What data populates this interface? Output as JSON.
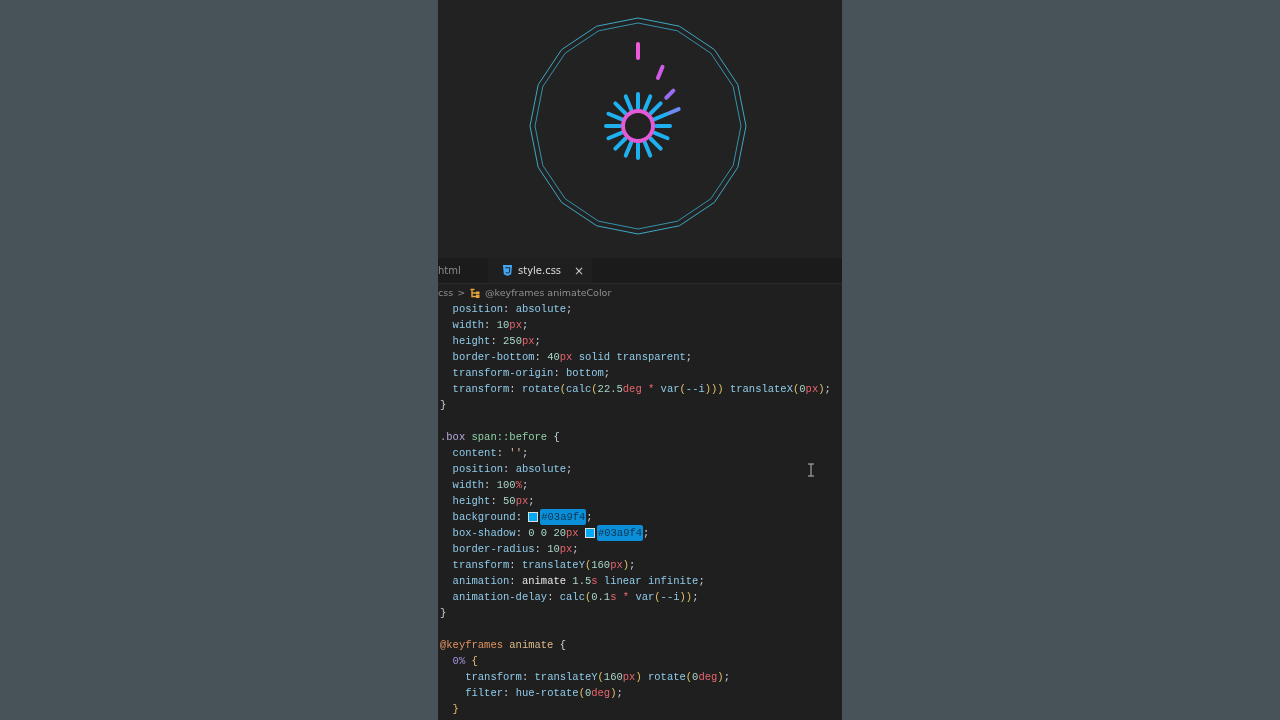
{
  "tabs": [
    {
      "label": "html",
      "selected": false,
      "kind": "plain"
    },
    {
      "label": "style.css",
      "selected": true,
      "kind": "css",
      "close": "×"
    }
  ],
  "breadcrumb": {
    "parts": [
      "css",
      ">"
    ],
    "symbol": "@keyframes animateColor"
  },
  "code_lines": [
    {
      "kind": "code",
      "segments": [
        {
          "kind": "text",
          "tokens": [
            {
              "text": "  position",
              "kind": "property"
            },
            {
              "text": ": ",
              "kind": "punct"
            },
            {
              "text": "absolute",
              "kind": "property"
            },
            {
              "text": ";",
              "kind": "punct"
            }
          ]
        }
      ]
    },
    {
      "kind": "code",
      "segments": [
        {
          "kind": "text",
          "tokens": [
            {
              "text": "  width",
              "kind": "property"
            },
            {
              "text": ": ",
              "kind": "punct"
            },
            {
              "text": "10",
              "kind": "number"
            },
            {
              "text": "px",
              "kind": "unit"
            },
            {
              "text": ";",
              "kind": "punct"
            }
          ]
        }
      ]
    },
    {
      "kind": "code",
      "segments": [
        {
          "kind": "text",
          "tokens": [
            {
              "text": "  height",
              "kind": "property"
            },
            {
              "text": ": ",
              "kind": "punct"
            },
            {
              "text": "250",
              "kind": "number"
            },
            {
              "text": "px",
              "kind": "unit"
            },
            {
              "text": ";",
              "kind": "punct"
            }
          ]
        }
      ]
    },
    {
      "kind": "code",
      "segments": [
        {
          "kind": "text",
          "tokens": [
            {
              "text": "  border-bottom",
              "kind": "property"
            },
            {
              "text": ": ",
              "kind": "punct"
            },
            {
              "text": "40",
              "kind": "number"
            },
            {
              "text": "px",
              "kind": "unit"
            },
            {
              "text": " solid transparent",
              "kind": "property"
            },
            {
              "text": ";",
              "kind": "punct"
            }
          ]
        }
      ]
    },
    {
      "kind": "code",
      "segments": [
        {
          "kind": "text",
          "tokens": [
            {
              "text": "  transform-origin",
              "kind": "property"
            },
            {
              "text": ": ",
              "kind": "punct"
            },
            {
              "text": "bottom",
              "kind": "property"
            },
            {
              "text": ";",
              "kind": "punct"
            }
          ]
        }
      ]
    },
    {
      "kind": "code",
      "segments": [
        {
          "kind": "text",
          "tokens": [
            {
              "text": "  transform",
              "kind": "property"
            },
            {
              "text": ": ",
              "kind": "punct"
            },
            {
              "text": "rotate",
              "kind": "property"
            },
            {
              "text": "(",
              "kind": "paren"
            },
            {
              "text": "calc",
              "kind": "property"
            },
            {
              "text": "(",
              "kind": "paren"
            },
            {
              "text": "22.5",
              "kind": "number"
            },
            {
              "text": "deg",
              "kind": "unit"
            },
            {
              "text": " * ",
              "kind": "operator"
            },
            {
              "text": "var",
              "kind": "property"
            },
            {
              "text": "(",
              "kind": "paren"
            },
            {
              "text": "--i",
              "kind": "property"
            },
            {
              "text": ")))",
              "kind": "paren"
            },
            {
              "text": " translateX",
              "kind": "property"
            },
            {
              "text": "(",
              "kind": "paren"
            },
            {
              "text": "0",
              "kind": "number"
            },
            {
              "text": "px",
              "kind": "unit"
            },
            {
              "text": ")",
              "kind": "paren"
            },
            {
              "text": ";",
              "kind": "punct"
            }
          ]
        }
      ]
    },
    {
      "kind": "code",
      "segments": [
        {
          "kind": "text",
          "tokens": [
            {
              "text": "}",
              "kind": "punct"
            }
          ]
        }
      ]
    },
    {
      "kind": "blank"
    },
    {
      "kind": "code",
      "segments": [
        {
          "kind": "text",
          "tokens": [
            {
              "text": ".box",
              "kind": "selector"
            },
            {
              "text": " span::before",
              "kind": "element"
            },
            {
              "text": " {",
              "kind": "punct"
            }
          ]
        }
      ]
    },
    {
      "kind": "code",
      "segments": [
        {
          "kind": "text",
          "tokens": [
            {
              "text": "  content",
              "kind": "property"
            },
            {
              "text": ": ",
              "kind": "punct"
            },
            {
              "text": "''",
              "kind": "string"
            },
            {
              "text": ";",
              "kind": "punct"
            }
          ]
        }
      ]
    },
    {
      "kind": "code",
      "segments": [
        {
          "kind": "text",
          "tokens": [
            {
              "text": "  position",
              "kind": "property"
            },
            {
              "text": ": ",
              "kind": "punct"
            },
            {
              "text": "absolute",
              "kind": "property"
            },
            {
              "text": ";",
              "kind": "punct"
            }
          ]
        }
      ]
    },
    {
      "kind": "code",
      "segments": [
        {
          "kind": "text",
          "tokens": [
            {
              "text": "  width",
              "kind": "property"
            },
            {
              "text": ": ",
              "kind": "punct"
            },
            {
              "text": "100",
              "kind": "number"
            },
            {
              "text": "%",
              "kind": "unit"
            },
            {
              "text": ";",
              "kind": "punct"
            }
          ]
        }
      ]
    },
    {
      "kind": "code",
      "segments": [
        {
          "kind": "text",
          "tokens": [
            {
              "text": "  height",
              "kind": "property"
            },
            {
              "text": ": ",
              "kind": "punct"
            },
            {
              "text": "50",
              "kind": "number"
            },
            {
              "text": "px",
              "kind": "unit"
            },
            {
              "text": ";",
              "kind": "punct"
            }
          ]
        }
      ]
    },
    {
      "kind": "code",
      "segments": [
        {
          "kind": "text",
          "tokens": [
            {
              "text": "  background",
              "kind": "property"
            },
            {
              "text": ": ",
              "kind": "punct"
            }
          ]
        },
        {
          "kind": "swatch",
          "color": "#03a9f4"
        },
        {
          "kind": "highlight",
          "text": "#03a9f4"
        },
        {
          "kind": "text",
          "tokens": [
            {
              "text": ";",
              "kind": "punct"
            }
          ]
        }
      ]
    },
    {
      "kind": "code",
      "segments": [
        {
          "kind": "text",
          "tokens": [
            {
              "text": "  box-shadow",
              "kind": "property"
            },
            {
              "text": ": ",
              "kind": "punct"
            },
            {
              "text": "0 0 20",
              "kind": "number"
            },
            {
              "text": "px ",
              "kind": "unit"
            }
          ]
        },
        {
          "kind": "swatch",
          "color": "#03a9f4"
        },
        {
          "kind": "highlight",
          "text": "#03a9f4"
        },
        {
          "kind": "text",
          "tokens": [
            {
              "text": ";",
              "kind": "punct"
            }
          ]
        }
      ]
    },
    {
      "kind": "code",
      "segments": [
        {
          "kind": "text",
          "tokens": [
            {
              "text": "  border-radius",
              "kind": "property"
            },
            {
              "text": ": ",
              "kind": "punct"
            },
            {
              "text": "10",
              "kind": "number"
            },
            {
              "text": "px",
              "kind": "unit"
            },
            {
              "text": ";",
              "kind": "punct"
            }
          ]
        }
      ]
    },
    {
      "kind": "code",
      "segments": [
        {
          "kind": "text",
          "tokens": [
            {
              "text": "  transform",
              "kind": "property"
            },
            {
              "text": ": ",
              "kind": "punct"
            },
            {
              "text": "translateY",
              "kind": "property"
            },
            {
              "text": "(",
              "kind": "paren"
            },
            {
              "text": "160",
              "kind": "number"
            },
            {
              "text": "px",
              "kind": "unit"
            },
            {
              "text": ")",
              "kind": "paren"
            },
            {
              "text": ";",
              "kind": "punct"
            }
          ]
        }
      ]
    },
    {
      "kind": "code",
      "segments": [
        {
          "kind": "text",
          "tokens": [
            {
              "text": "  animation",
              "kind": "property"
            },
            {
              "text": ": ",
              "kind": "punct"
            },
            {
              "text": "animate",
              "kind": "plain"
            },
            {
              "text": " 1.5",
              "kind": "number"
            },
            {
              "text": "s",
              "kind": "unit"
            },
            {
              "text": " linear infinite",
              "kind": "property"
            },
            {
              "text": ";",
              "kind": "punct"
            }
          ]
        }
      ]
    },
    {
      "kind": "code",
      "segments": [
        {
          "kind": "text",
          "tokens": [
            {
              "text": "  animation-delay",
              "kind": "property"
            },
            {
              "text": ": ",
              "kind": "punct"
            },
            {
              "text": "calc",
              "kind": "property"
            },
            {
              "text": "(",
              "kind": "paren"
            },
            {
              "text": "0.1",
              "kind": "number"
            },
            {
              "text": "s",
              "kind": "unit"
            },
            {
              "text": " * ",
              "kind": "operator"
            },
            {
              "text": "var",
              "kind": "property"
            },
            {
              "text": "(",
              "kind": "paren"
            },
            {
              "text": "--i",
              "kind": "property"
            },
            {
              "text": "))",
              "kind": "paren"
            },
            {
              "text": ";",
              "kind": "punct"
            }
          ]
        }
      ]
    },
    {
      "kind": "code",
      "segments": [
        {
          "kind": "text",
          "tokens": [
            {
              "text": "}",
              "kind": "punct"
            }
          ]
        }
      ]
    },
    {
      "kind": "blank"
    },
    {
      "kind": "code",
      "segments": [
        {
          "kind": "text",
          "tokens": [
            {
              "text": "@keyframes",
              "kind": "at_rule"
            },
            {
              "text": " animate",
              "kind": "name"
            },
            {
              "text": " {",
              "kind": "punct"
            }
          ]
        }
      ]
    },
    {
      "kind": "code",
      "segments": [
        {
          "kind": "text",
          "tokens": [
            {
              "text": "  0%",
              "kind": "percent"
            },
            {
              "text": " {",
              "kind": "paren"
            }
          ]
        }
      ]
    },
    {
      "kind": "code",
      "segments": [
        {
          "kind": "text",
          "tokens": [
            {
              "text": "    transform",
              "kind": "property"
            },
            {
              "text": ": ",
              "kind": "punct"
            },
            {
              "text": "translateY",
              "kind": "property"
            },
            {
              "text": "(",
              "kind": "paren"
            },
            {
              "text": "160",
              "kind": "number"
            },
            {
              "text": "px",
              "kind": "unit"
            },
            {
              "text": ")",
              "kind": "paren"
            },
            {
              "text": " rotate",
              "kind": "property"
            },
            {
              "text": "(",
              "kind": "paren"
            },
            {
              "text": "0",
              "kind": "number"
            },
            {
              "text": "deg",
              "kind": "unit"
            },
            {
              "text": ")",
              "kind": "paren"
            },
            {
              "text": ";",
              "kind": "punct"
            }
          ]
        }
      ]
    },
    {
      "kind": "code",
      "segments": [
        {
          "kind": "text",
          "tokens": [
            {
              "text": "    filter",
              "kind": "property"
            },
            {
              "text": ": ",
              "kind": "punct"
            },
            {
              "text": "hue-rotate",
              "kind": "property"
            },
            {
              "text": "(",
              "kind": "paren"
            },
            {
              "text": "0",
              "kind": "number"
            },
            {
              "text": "deg",
              "kind": "unit"
            },
            {
              "text": ")",
              "kind": "paren"
            },
            {
              "text": ";",
              "kind": "punct"
            }
          ]
        }
      ]
    },
    {
      "kind": "code",
      "segments": [
        {
          "kind": "text",
          "tokens": [
            {
              "text": "  }",
              "kind": "paren"
            }
          ]
        }
      ]
    }
  ]
}
